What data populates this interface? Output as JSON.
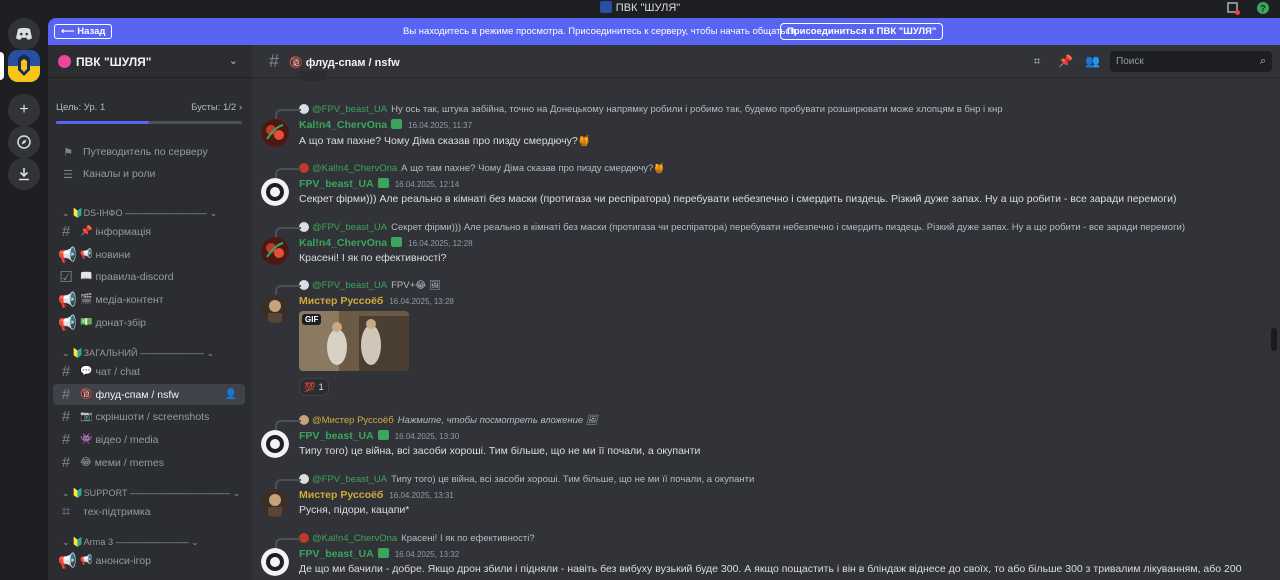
{
  "window": {
    "title": "ПВК \"ШУЛЯ\""
  },
  "banner": {
    "back_label": "Назад",
    "message": "Вы находитесь в режиме просмотра. Присоединитесь к серверу, чтобы начать общаться.",
    "join_label": "Присоединиться к ПВК \"ШУЛЯ\""
  },
  "server": {
    "name": "ПВК \"ШУЛЯ\"",
    "goal_label": "Цель: Ур. 1",
    "boosts_label": "Бусты: 1/2 ›",
    "goal_progress": 0.5
  },
  "nav": {
    "guide": "Путеводитель по серверу",
    "channels_roles": "Каналы и роли"
  },
  "categories": [
    {
      "label": "DS-ІНФО ————————— ⌄"
    },
    {
      "label": "ЗАГАЛЬНИЙ ——————— ⌄"
    },
    {
      "label": "SUPPORT ——————————— ⌄"
    },
    {
      "label": "Arma 3 ———————— ⌄"
    }
  ],
  "channels": [
    {
      "emoji": "📌",
      "label": "інформація"
    },
    {
      "emoji": "📢",
      "label": "новини"
    },
    {
      "emoji": "📖",
      "label": "правила-discord"
    },
    {
      "emoji": "🎬",
      "label": "медіа-контент"
    },
    {
      "emoji": "💵",
      "label": "донат-збір"
    },
    {
      "emoji": "💬",
      "label": "чат / chat"
    },
    {
      "emoji": "🔞",
      "label": "флуд-спам / nsfw"
    },
    {
      "emoji": "📷",
      "label": "скріншоти / screenshots"
    },
    {
      "emoji": "👾",
      "label": "відео / media"
    },
    {
      "emoji": "😂",
      "label": "меми / memes"
    },
    {
      "emoji": "",
      "label": "тех-підтримка"
    },
    {
      "emoji": "📢",
      "label": "анонси-ігор"
    }
  ],
  "header": {
    "channel_name": "флуд-спам / nsfw",
    "search_placeholder": "Поиск"
  },
  "colors": {
    "kal_name": "#3ba55c",
    "fpv_name": "#3ba55c",
    "mister_name": "#d4a93b",
    "accent": "#5865f2"
  },
  "messages": [
    {
      "reply_author": "@FPV_beast_UA",
      "reply_text": "Ну ось так, штука забійна, точно на Донецькому напрямку робили і робимо так, будемо пробувати розширювати може хлопцям в бнр і кнр",
      "author": "Kal!n4_ChervOna",
      "time": "16.04.2025, 11:37",
      "text": "А що там пахне? Чому Діма сказав про пизду смердючу?🍯"
    },
    {
      "reply_author": "@Kal!n4_ChervOna",
      "reply_text": "А що там пахне? Чому Діма сказав про пизду смердючу?🍯",
      "author": "FPV_beast_UA",
      "time": "16.04.2025, 12:14",
      "text": "Секрет фірми))) Але реально в кімнаті без маски (протигаза чи респіратора) перебувати небезпечно і смердить пиздець. Різкий дуже запах. Ну а що робити - все заради перемоги)"
    },
    {
      "reply_author": "@FPV_beast_UA",
      "reply_text": "Секрет фірми))) Але реально в кімнаті без маски (протигаза чи респіратора) перебувати небезпечно і смердить пиздець. Різкий дуже запах. Ну а що робити - все заради перемоги)",
      "author": "Kal!n4_ChervOna",
      "time": "16.04.2025, 12:28",
      "text": "Красені! І як по ефективності?"
    },
    {
      "reply_author": "@FPV_beast_UA",
      "reply_text": "FPV+😂 🖼",
      "author": "Мистер Руссоёб",
      "time": "16.04.2025, 13:28",
      "text": "",
      "gif_label": "GIF",
      "reaction": {
        "emoji": "💯",
        "count": "1"
      }
    },
    {
      "reply_author": "@Мистер Руссоёб",
      "reply_text": "Нажмите, чтобы посмотреть вложение 🖼",
      "author": "FPV_beast_UA",
      "time": "16.04.2025, 13:30",
      "text": "Типу того) це війна, всі засоби хороші. Тим більше, що не ми її почали, а окупанти"
    },
    {
      "reply_author": "@FPV_beast_UA",
      "reply_text": "Типу того) це війна, всі засоби хороші. Тим більше, що не ми її почали, а окупанти",
      "author": "Мистер Руссоёб",
      "time": "16.04.2025, 13:31",
      "text": "Русня, підори, кацапи*"
    },
    {
      "reply_author": "@Kal!n4_ChervOna",
      "reply_text": "Красені! І як по ефективності?",
      "author": "FPV_beast_UA",
      "time": "16.04.2025, 13:32",
      "text": "Де що ми бачили - добре. Якщо дрон збили і підняли - навіть без вибуху вузький буде 300. А якщо пощастить і він в бліндаж віднесе до своїх, то або більше 300 з тривалим лікуванням, або 200"
    }
  ]
}
